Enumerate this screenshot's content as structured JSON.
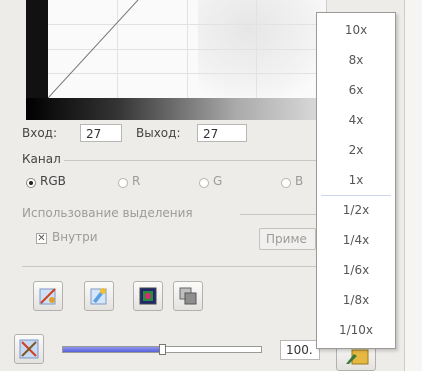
{
  "curves": {
    "input_label": "Вход:",
    "input_value": "27",
    "output_label": "Выход:",
    "output_value": "27"
  },
  "channel": {
    "title": "Канал",
    "options": [
      {
        "label": "RGB",
        "selected": true
      },
      {
        "label": "R",
        "selected": false
      },
      {
        "label": "G",
        "selected": false
      },
      {
        "label": "B",
        "selected": false
      }
    ]
  },
  "selection": {
    "title": "Использование выделения",
    "inside_label": "Внутри",
    "inside_checked": true,
    "apply_label": "Приме"
  },
  "tools": {
    "buttons": [
      "clear-brush-icon",
      "paint-brush-icon",
      "image-preview-icon",
      "copy-layers-icon"
    ]
  },
  "bottom": {
    "zoom_value": "100.",
    "slider_level": 0.5
  },
  "zoom_menu": {
    "items": [
      "10x",
      "8x",
      "6x",
      "4x",
      "2x",
      "1x",
      "1/2x",
      "1/4x",
      "1/6x",
      "1/8x",
      "1/10x"
    ]
  }
}
